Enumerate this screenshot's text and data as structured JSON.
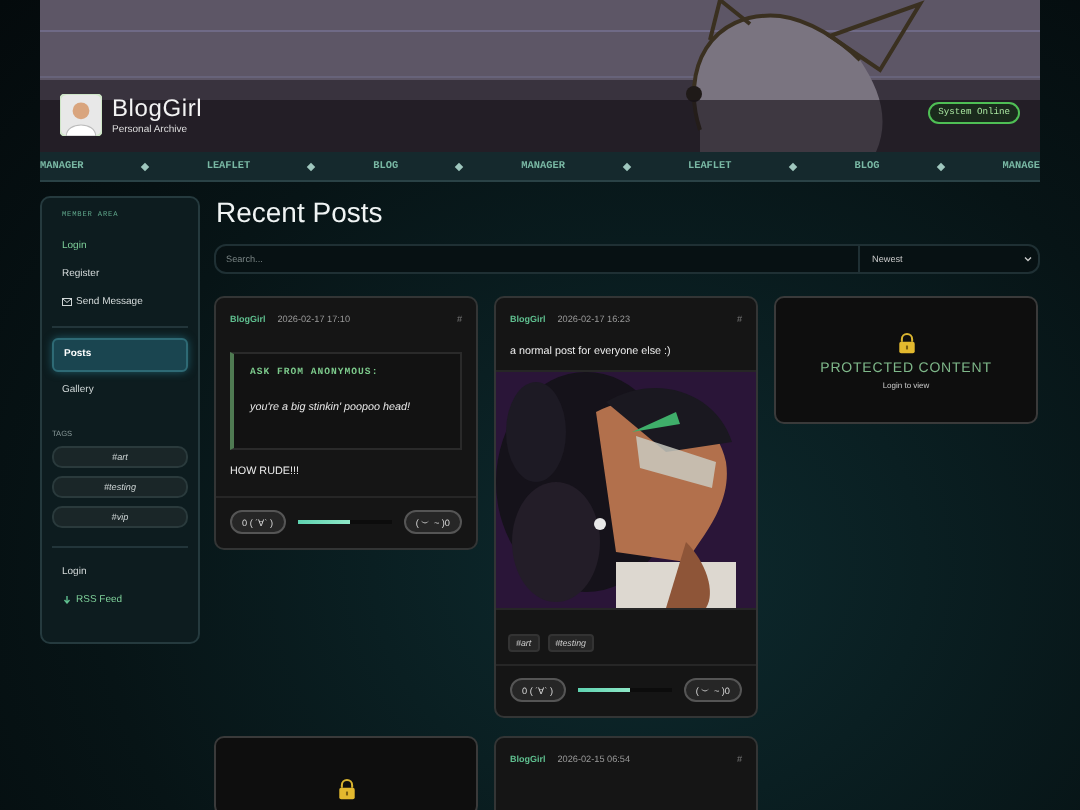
{
  "header": {
    "title": "BlogGirl",
    "subtitle": "Personal Archive",
    "status_badge": "System Online"
  },
  "ticker": [
    "MANAGER",
    "LEAFLET",
    "BLOG",
    "MANAGER",
    "LEAFLET",
    "BLOG",
    "MANAGE"
  ],
  "sidebar": {
    "section_title": "MEMBER AREA",
    "member_links": [
      {
        "label": "Login",
        "kind": "accent"
      },
      {
        "label": "Register",
        "kind": "plain"
      },
      {
        "label": "Send Message",
        "kind": "mail"
      }
    ],
    "nav": [
      {
        "label": "Posts",
        "selected": true
      },
      {
        "label": "Gallery",
        "selected": false
      }
    ],
    "tags_title": "TAGS",
    "tags": [
      "#art",
      "#testing",
      "#vip"
    ],
    "footer_links": [
      {
        "label": "Login",
        "kind": "plain"
      },
      {
        "label": "RSS Feed",
        "kind": "rss"
      }
    ]
  },
  "main": {
    "title": "Recent Posts",
    "search": {
      "placeholder": "Search..."
    },
    "sort": "Newest",
    "posts": [
      {
        "kind": "ask",
        "author": "BlogGirl",
        "date": "2026-02-17 17:10",
        "permalink": "#",
        "ask_title": "ASK FROM ANONYMOUS:",
        "ask_text": "you're a big stinkin' poopoo head!",
        "body": "HOW RUDE!!!",
        "like": "0 ( ´∀` )",
        "dislike": "( ︶ ~ )0",
        "level": 0.55
      },
      {
        "author": "BlogGirl",
        "date": "2026-02-17 16:23",
        "permalink": "#",
        "body": "a normal post for everyone else :)",
        "tags": [
          "#art",
          "#testing"
        ],
        "like": "0 ( ´∀` )",
        "dislike": "( ︶ ~ )0",
        "level": 0.55
      },
      {
        "kind": "protected",
        "title": "PROTECTED CONTENT",
        "subtitle": "Login to view"
      },
      {
        "kind": "protected"
      },
      {
        "kind": "header_only",
        "author": "BlogGirl",
        "date": "2026-02-15 06:54",
        "permalink": "#"
      }
    ]
  }
}
